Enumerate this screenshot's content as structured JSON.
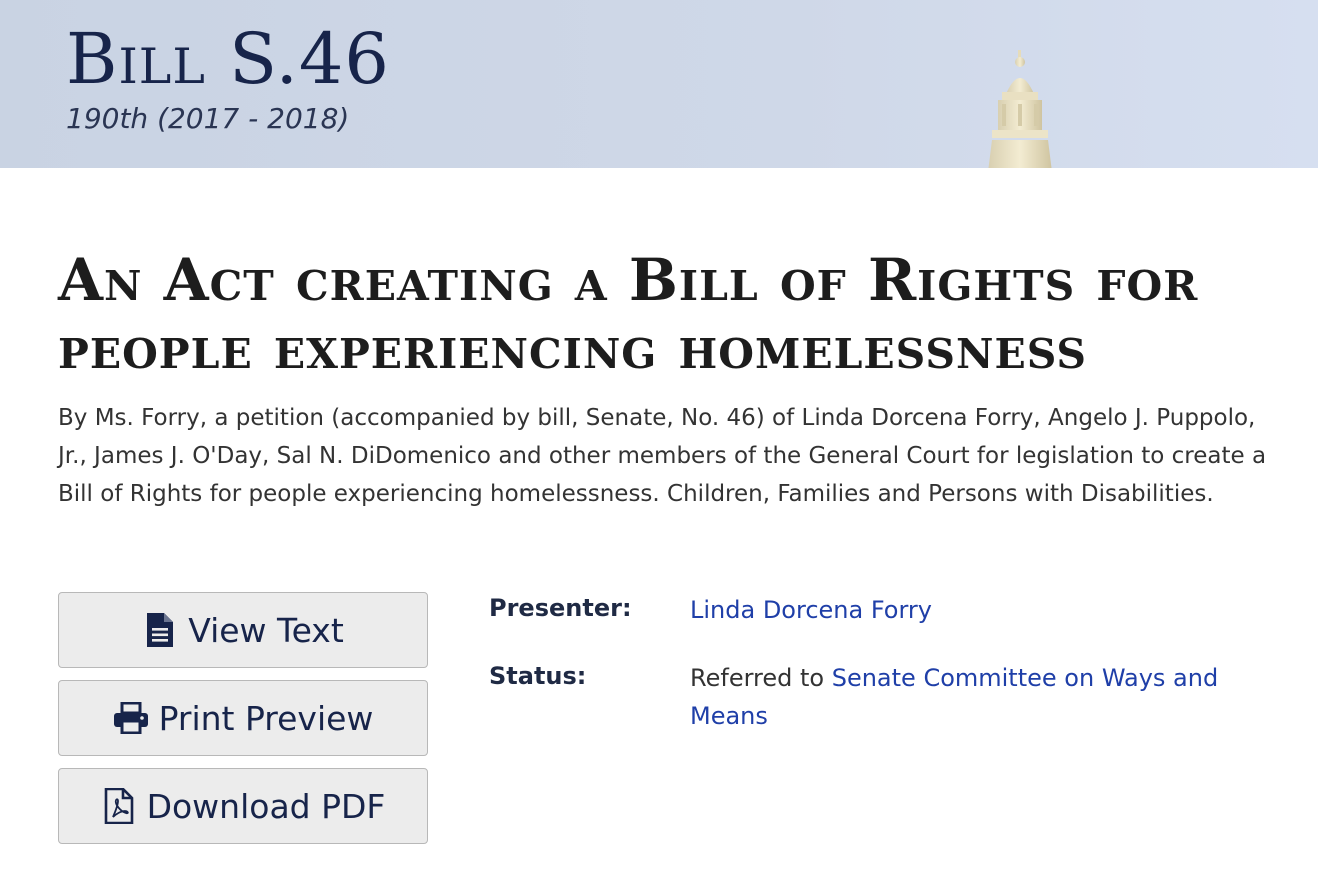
{
  "banner": {
    "title": "Bill S.46",
    "session": "190th (2017 - 2018)",
    "background_color": "#cfd8e8"
  },
  "act": {
    "title": "An Act creating a Bill of Rights for people experiencing homelessness",
    "summary": "By Ms. Forry, a petition (accompanied by bill, Senate, No. 46) of Linda Dorcena Forry, Angelo J. Puppolo, Jr., James J. O'Day, Sal N. DiDomenico and other members of the General Court for legislation to create a Bill of Rights for people experiencing homelessness. Children, Families and Persons with Disabilities."
  },
  "actions": {
    "view_text": {
      "label": "View Text",
      "icon": "document-icon"
    },
    "print_preview": {
      "label": "Print Preview",
      "icon": "printer-icon"
    },
    "download_pdf": {
      "label": "Download PDF",
      "icon": "pdf-file-icon"
    }
  },
  "details": {
    "presenter_label": "Presenter:",
    "presenter_name": "Linda Dorcena Forry",
    "status_label": "Status:",
    "status_prefix": "Referred to ",
    "status_committee": "Senate Committee on Ways and Means"
  },
  "colors": {
    "link": "#1f3fa8",
    "heading": "#17244a",
    "button_bg": "#ececec"
  }
}
